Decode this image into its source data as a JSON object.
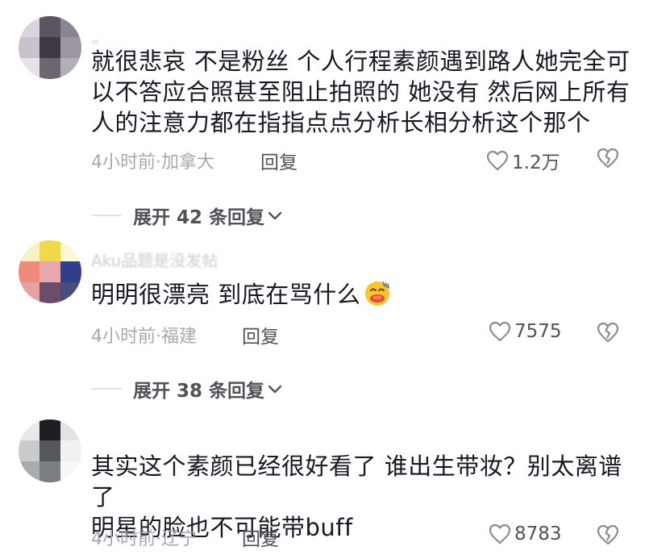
{
  "comments": [
    {
      "username": "„",
      "text_lines": [
        "就很悲哀 不是粉丝 个人行程素颜遇到路人她完全可",
        "以不答应合照甚至阻止拍照的 她没有 然后网上所有",
        "人的注意力都在指指点点分析长相分析这个那个"
      ],
      "time_location": "4小时前·加拿大",
      "reply_label": "回复",
      "likes": "1.2万",
      "expand_label": "展开 42 条回复"
    },
    {
      "username": "Aku品题是没发帖",
      "text_lines": [
        "明明很漂亮 到底在骂什么"
      ],
      "emoji": "face-with-tongue-emoji",
      "time_location": "4小时前·福建",
      "reply_label": "回复",
      "likes": "7575",
      "expand_label": "展开 38 条回复"
    },
    {
      "username": "",
      "text_lines": [
        "其实这个素颜已经很好看了 谁出生带妆？别太离谱了",
        "明星的脸也不可能带buff"
      ],
      "time_location": "4小时前·辽宁",
      "reply_label": "回复",
      "likes": "8783"
    }
  ],
  "icons": {
    "like": "heart-outline-icon",
    "dislike": "broken-heart-icon",
    "expand": "chevron-down-icon"
  },
  "colors": {
    "text": "#161823",
    "meta": "#a6a8ad",
    "action": "#505258"
  }
}
